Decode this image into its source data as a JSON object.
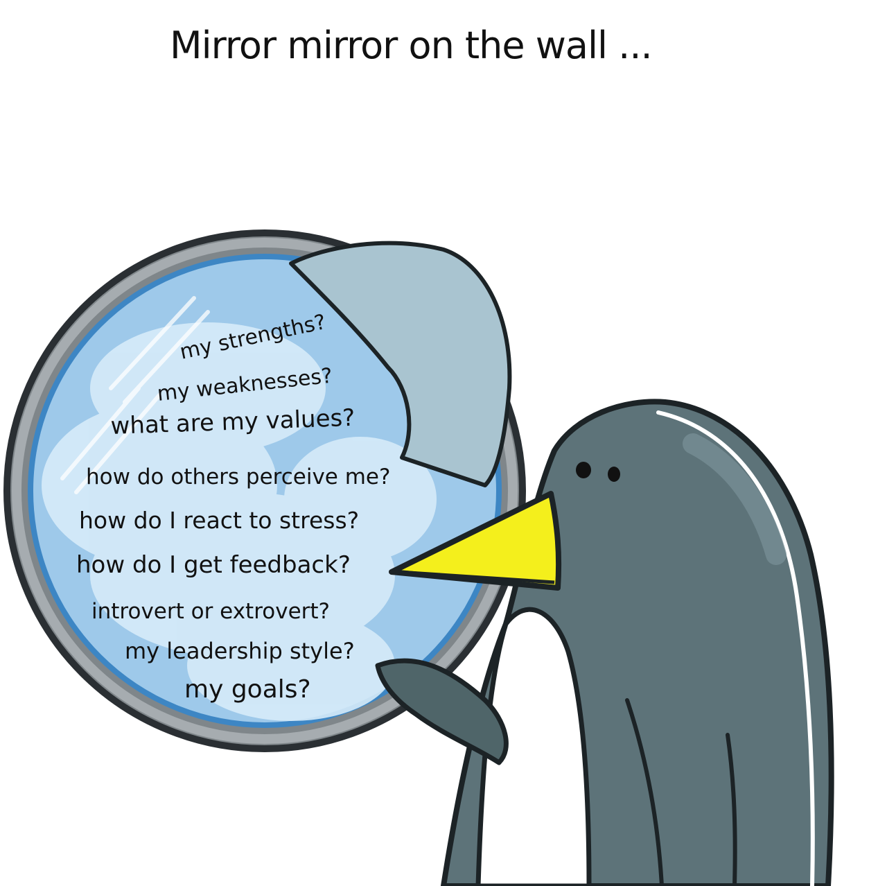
{
  "title": "Mirror mirror on the wall ...",
  "mirror_questions": [
    "my strengths?",
    "my weaknesses?",
    "what are my values?",
    "how do others perceive me?",
    "how do I react to stress?",
    "how do I get feedback?",
    "introvert or extrovert?",
    "my leadership style?",
    "my goals?"
  ],
  "colors": {
    "background": "#ffffff",
    "mirror_frame": "#8a8f93",
    "mirror_glass": "#9ec9ea",
    "mirror_glass_light": "#d6ebf9",
    "reflection": "#a9c4d0",
    "penguin_body": "#5d7379",
    "penguin_belly": "#ffffff",
    "beak": "#f4ef1c",
    "outline": "#1c2326"
  }
}
